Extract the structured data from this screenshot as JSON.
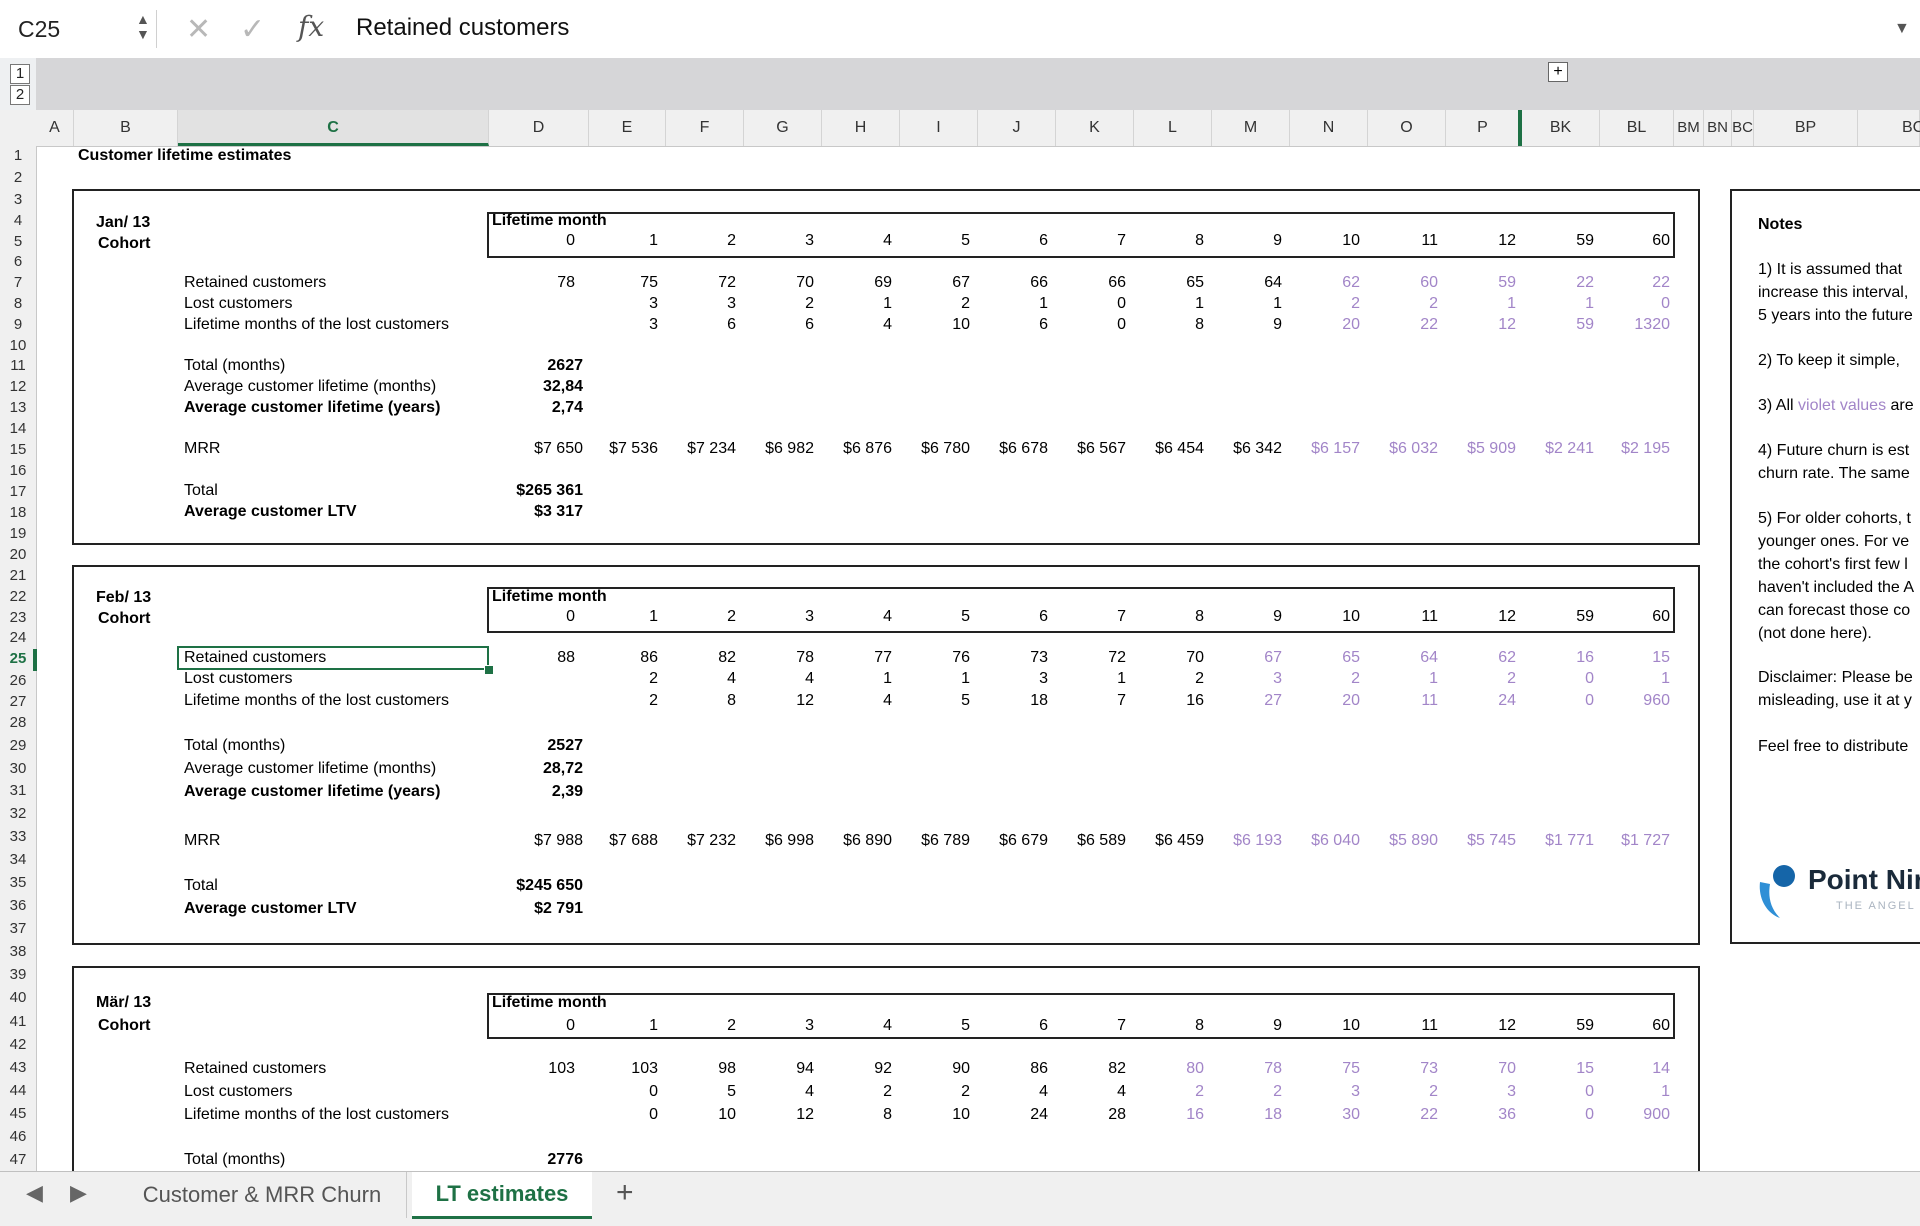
{
  "formula_bar": {
    "cell_ref": "C25",
    "content": "Retained customers",
    "cancel_icon": "x-icon",
    "confirm_icon": "check-icon",
    "fx_label": "fx"
  },
  "outline": {
    "levels": [
      "1",
      "2"
    ],
    "expand_symbol": "+"
  },
  "columns": [
    "A",
    "B",
    "C",
    "D",
    "E",
    "F",
    "G",
    "H",
    "I",
    "J",
    "K",
    "L",
    "M",
    "N",
    "O",
    "P",
    "BK",
    "BL",
    "BM",
    "BN",
    "BC",
    "BP",
    "BC"
  ],
  "rows": [
    "1",
    "2",
    "3",
    "4",
    "5",
    "6",
    "7",
    "8",
    "9",
    "10",
    "11",
    "12",
    "13",
    "14",
    "15",
    "16",
    "17",
    "18",
    "19",
    "20",
    "21",
    "22",
    "23",
    "24",
    "25",
    "26",
    "27",
    "28",
    "29",
    "30",
    "31",
    "32",
    "33",
    "34",
    "35",
    "36",
    "37",
    "38",
    "39",
    "40",
    "41",
    "42",
    "43",
    "44",
    "45",
    "46",
    "47"
  ],
  "sheet_title": "Customer lifetime estimates",
  "labels": {
    "lifetime_month": "Lifetime month",
    "cohort": "Cohort",
    "retained": "Retained customers",
    "lost": "Lost customers",
    "lifetime_lost": "Lifetime months of the lost customers",
    "total_months": "Total (months)",
    "avg_months": "Average customer lifetime (months)",
    "avg_years": "Average customer lifetime (years)",
    "mrr": "MRR",
    "total": "Total",
    "avg_ltv": "Average customer LTV"
  },
  "months": [
    "0",
    "1",
    "2",
    "3",
    "4",
    "5",
    "6",
    "7",
    "8",
    "9",
    "10",
    "11",
    "12",
    "59",
    "60"
  ],
  "cohorts": [
    {
      "label": "Jan/ 13",
      "retained": [
        "78",
        "75",
        "72",
        "70",
        "69",
        "67",
        "66",
        "66",
        "65",
        "64",
        "62",
        "60",
        "59",
        "22",
        "22"
      ],
      "lost": [
        "",
        "3",
        "3",
        "2",
        "1",
        "2",
        "1",
        "0",
        "1",
        "1",
        "2",
        "2",
        "1",
        "1",
        "0"
      ],
      "lifetime": [
        "",
        "3",
        "6",
        "6",
        "4",
        "10",
        "6",
        "0",
        "8",
        "9",
        "20",
        "22",
        "12",
        "59",
        "1320"
      ],
      "total_months": "2627",
      "avg_months": "32,84",
      "avg_years": "2,74",
      "mrr": [
        "$7 650",
        "$7 536",
        "$7 234",
        "$6 982",
        "$6 876",
        "$6 780",
        "$6 678",
        "$6 567",
        "$6 454",
        "$6 342",
        "$6 157",
        "$6 032",
        "$5 909",
        "$2 241",
        "$2 195"
      ],
      "total": "$265 361",
      "avg_ltv": "$3 317"
    },
    {
      "label": "Feb/ 13",
      "retained": [
        "88",
        "86",
        "82",
        "78",
        "77",
        "76",
        "73",
        "72",
        "70",
        "67",
        "65",
        "64",
        "62",
        "16",
        "15"
      ],
      "lost": [
        "",
        "2",
        "4",
        "4",
        "1",
        "1",
        "3",
        "1",
        "2",
        "3",
        "2",
        "1",
        "2",
        "0",
        "1"
      ],
      "lifetime": [
        "",
        "2",
        "8",
        "12",
        "4",
        "5",
        "18",
        "7",
        "16",
        "27",
        "20",
        "11",
        "24",
        "0",
        "960"
      ],
      "total_months": "2527",
      "avg_months": "28,72",
      "avg_years": "2,39",
      "mrr": [
        "$7 988",
        "$7 688",
        "$7 232",
        "$6 998",
        "$6 890",
        "$6 789",
        "$6 679",
        "$6 589",
        "$6 459",
        "$6 193",
        "$6 040",
        "$5 890",
        "$5 745",
        "$1 771",
        "$1 727"
      ],
      "total": "$245 650",
      "avg_ltv": "$2 791"
    },
    {
      "label": "Mär/ 13",
      "retained": [
        "103",
        "103",
        "98",
        "94",
        "92",
        "90",
        "86",
        "82",
        "80",
        "78",
        "75",
        "73",
        "70",
        "15",
        "14"
      ],
      "lost": [
        "",
        "0",
        "5",
        "4",
        "2",
        "2",
        "4",
        "4",
        "2",
        "2",
        "3",
        "2",
        "3",
        "0",
        "1"
      ],
      "lifetime": [
        "",
        "0",
        "10",
        "12",
        "8",
        "10",
        "24",
        "28",
        "16",
        "18",
        "30",
        "22",
        "36",
        "0",
        "900"
      ],
      "total_months": "2776"
    }
  ],
  "notes": {
    "title": "Notes",
    "n1": "1) It is assumed that\nincrease this interval,\n5 years into the future",
    "n2": "2) To keep it simple,",
    "n3_prefix": "3) All ",
    "n3_violet": "violet values",
    "n3_suffix": " are",
    "n4": "4) Future churn is est\nchurn rate. The same",
    "n5": "5) For older cohorts, t\nyounger ones. For ve\nthe cohort's first few l\nhaven't included the A\ncan forecast those co\n(not done here).",
    "disclaimer": "Disclaimer: Please be\nmisleading, use it at y",
    "distribute": "Feel free to distribute",
    "logo": "Point Nir",
    "logo_sub": "THE ANGEL"
  },
  "tabs": {
    "items": [
      "Customer & MRR Churn",
      "LT estimates"
    ],
    "active": "LT estimates",
    "add": "+",
    "prev": "◀",
    "next": "▶"
  },
  "colors": {
    "accent": "#1e7145",
    "violet": "#a285c8"
  }
}
